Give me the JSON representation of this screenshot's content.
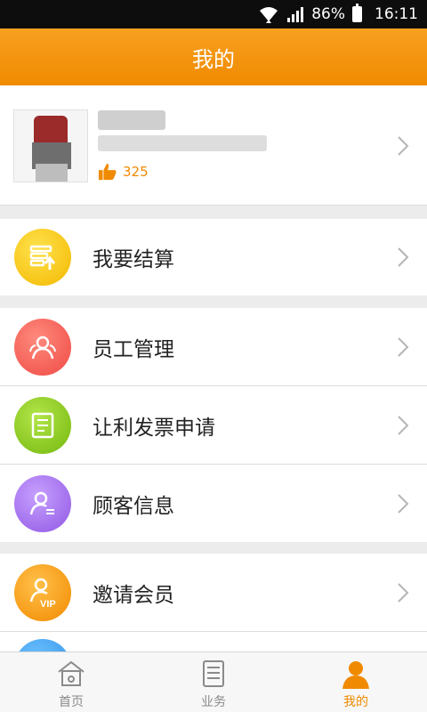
{
  "status_bar": {
    "battery": "86%",
    "time": "16:11"
  },
  "header": {
    "title": "我的"
  },
  "profile": {
    "likes": "325"
  },
  "menu": [
    {
      "label": "我要结算",
      "icon": "settlement-upload-icon",
      "color": "#f7c600"
    },
    {
      "label": "员工管理",
      "icon": "staff-group-icon",
      "color": "#f2574f"
    },
    {
      "label": "让利发票申请",
      "icon": "invoice-document-icon",
      "color": "#86c61b"
    },
    {
      "label": "顾客信息",
      "icon": "customer-info-icon",
      "color": "#a26ee8"
    },
    {
      "label": "邀请会员",
      "icon": "vip-member-icon",
      "color": "#f59b0b"
    }
  ],
  "tabs": [
    {
      "label": "首页",
      "icon": "home-icon"
    },
    {
      "label": "业务",
      "icon": "business-list-icon"
    },
    {
      "label": "我的",
      "icon": "profile-person-icon",
      "active": true
    }
  ],
  "colors": {
    "brand_orange": "#f08a00",
    "tab_inactive": "#8a8a8a"
  }
}
